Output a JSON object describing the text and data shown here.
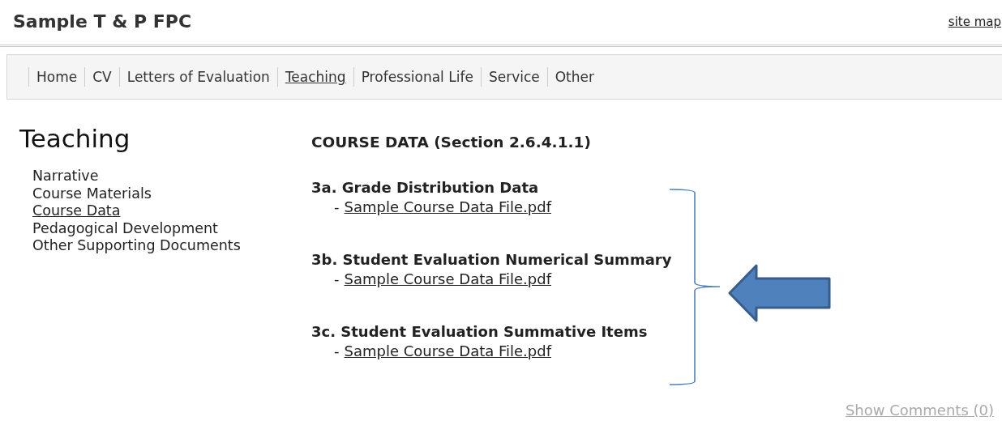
{
  "site": {
    "title": "Sample T & P FPC",
    "site_map_link": "site map"
  },
  "nav": [
    {
      "label": "Home",
      "selected": false
    },
    {
      "label": "CV",
      "selected": false
    },
    {
      "label": "Letters of Evaluation",
      "selected": false
    },
    {
      "label": "Teaching",
      "selected": true
    },
    {
      "label": "Professional Life",
      "selected": false
    },
    {
      "label": "Service",
      "selected": false
    },
    {
      "label": "Other",
      "selected": false
    }
  ],
  "sidebar": {
    "heading": "Teaching",
    "items": [
      {
        "label": "Narrative",
        "selected": false
      },
      {
        "label": "Course Materials",
        "selected": false
      },
      {
        "label": "Course Data",
        "selected": true
      },
      {
        "label": "Pedagogical Development",
        "selected": false
      },
      {
        "label": "Other Supporting Documents",
        "selected": false
      }
    ]
  },
  "content": {
    "heading": "COURSE DATA (Section 2.6.4.1.1)",
    "sections": [
      {
        "title": "3a. Grade Distribution Data",
        "prefix": "-",
        "file_link": "Sample Course Data File.pdf"
      },
      {
        "title": "3b. Student Evaluation Numerical Summary",
        "prefix": "-",
        "file_link": "Sample Course Data File.pdf"
      },
      {
        "title": "3c. Student Evaluation Summative Items",
        "prefix": "-",
        "file_link": "Sample Course Data File.pdf"
      }
    ]
  },
  "footer": {
    "comments_link": "Show Comments (0)"
  }
}
